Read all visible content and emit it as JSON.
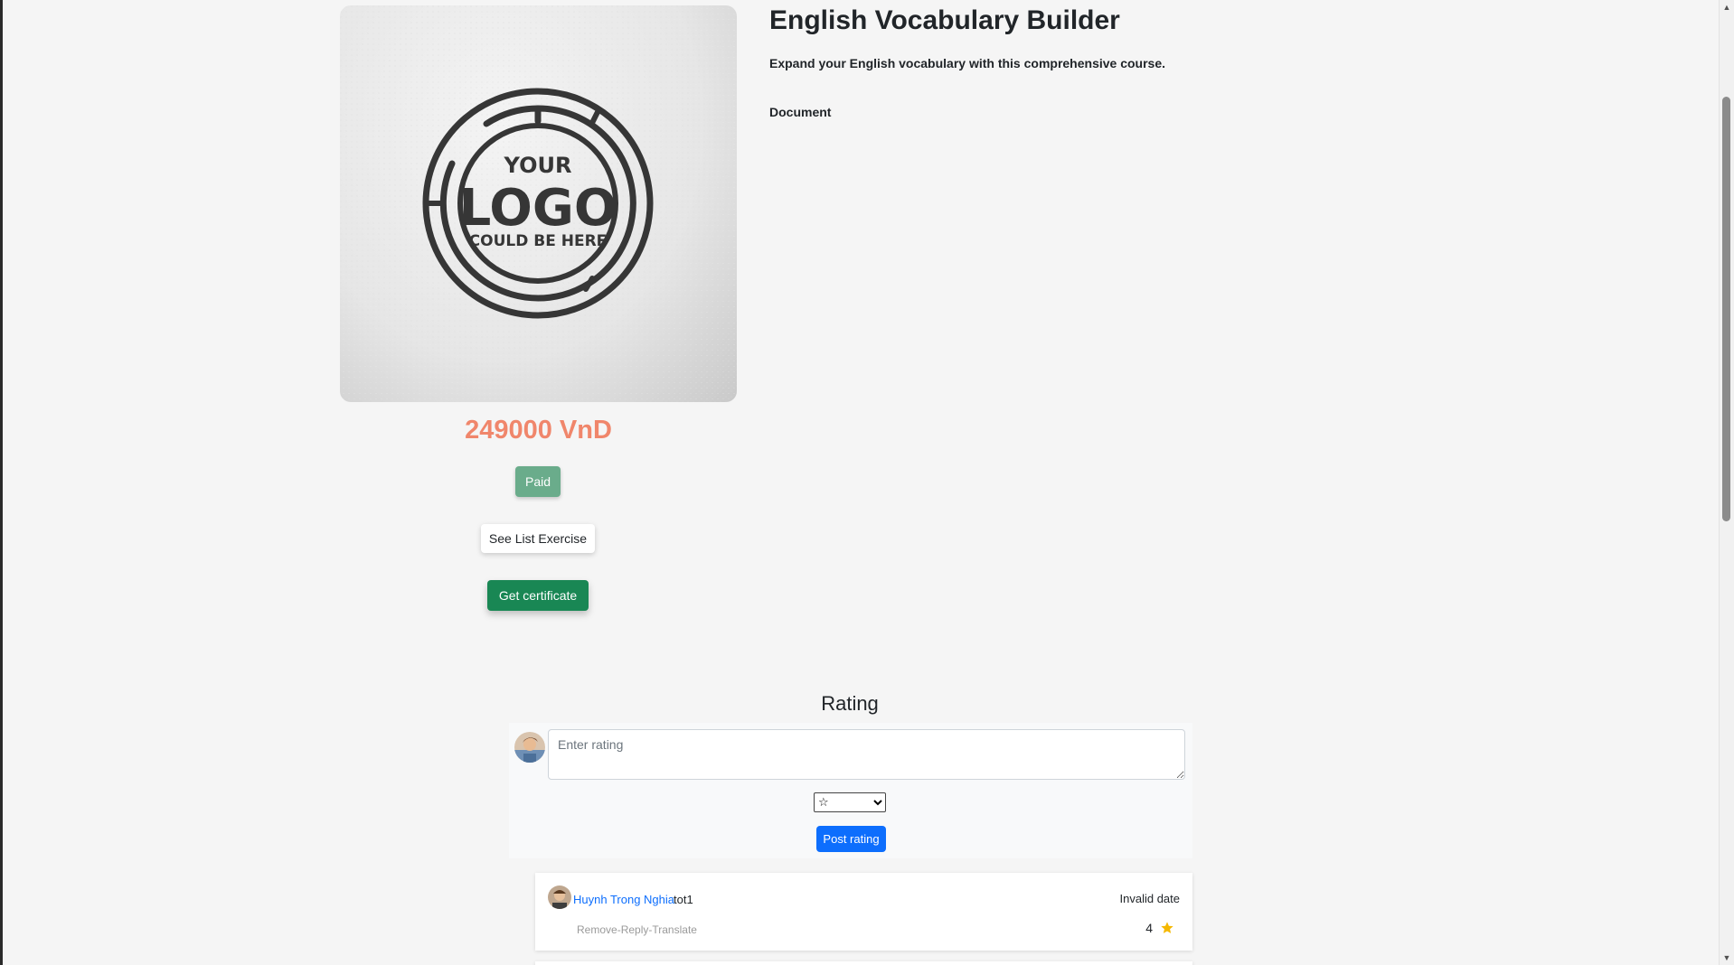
{
  "course": {
    "title": "English Vocabulary Builder",
    "description": "Expand your English vocabulary with this comprehensive course.",
    "document_label": "Document",
    "image_logo_text": [
      "YOUR",
      "LOGO",
      "COULD BE HERE"
    ],
    "price": "249000 VnD",
    "paid_badge": "Paid",
    "see_list_label": "See List Exercise",
    "certificate_label": "Get certificate"
  },
  "rating": {
    "heading": "Rating",
    "input_placeholder": "Enter rating",
    "select_value": "☆",
    "post_label": "Post rating",
    "comments": [
      {
        "author": "Huynh Trong Nghia",
        "text": "tot1",
        "date": "Invalid date",
        "actions": [
          "Remove",
          "Reply",
          "Translate"
        ],
        "score": "4"
      }
    ]
  },
  "colors": {
    "price": "#f0866b",
    "paid": "#6aac8b",
    "certificate": "#198754",
    "primary": "#0d6efd",
    "star": "#f5b800"
  },
  "icons": {
    "scroll_up": "triangle-up-icon",
    "scroll_down": "triangle-down-icon",
    "rating_star": "star-icon"
  }
}
